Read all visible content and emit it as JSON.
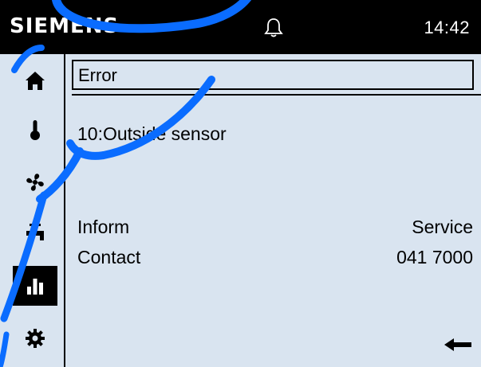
{
  "header": {
    "brand": "SIEMENS",
    "time": "14:42",
    "bell_icon": "bell-icon"
  },
  "sidebar": {
    "items": [
      {
        "name": "home",
        "icon": "home-icon",
        "active": false
      },
      {
        "name": "temperature",
        "icon": "thermometer-icon",
        "active": false
      },
      {
        "name": "ventilation",
        "icon": "fan-icon",
        "active": false
      },
      {
        "name": "hot-water",
        "icon": "faucet-icon",
        "active": false
      },
      {
        "name": "information",
        "icon": "bar-chart-icon",
        "active": true
      },
      {
        "name": "settings",
        "icon": "gear-icon",
        "active": false
      }
    ]
  },
  "main": {
    "title": "Error",
    "message": "10:Outside sensor",
    "rows": [
      {
        "label": "Inform",
        "value": "Service"
      },
      {
        "label": "Contact",
        "value": "041 7000"
      }
    ],
    "back_icon": "back-arrow-icon"
  },
  "colors": {
    "background": "#d9e4f0",
    "header": "#000000",
    "watermark": "#0a6cff"
  }
}
